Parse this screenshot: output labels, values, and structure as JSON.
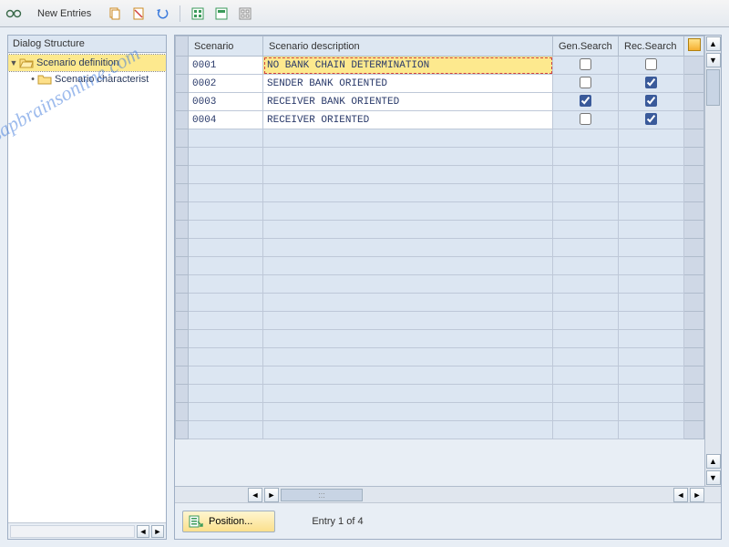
{
  "toolbar": {
    "new_entries_label": "New Entries"
  },
  "dialog_structure": {
    "header": "Dialog Structure",
    "root": {
      "label": "Scenario definition",
      "expanded": true
    },
    "child": {
      "label": "Scenario characterist"
    }
  },
  "table": {
    "headers": {
      "scenario": "Scenario",
      "description": "Scenario description",
      "gen_search": "Gen.Search",
      "rec_search": "Rec.Search"
    },
    "rows": [
      {
        "scenario": "0001",
        "description": "NO BANK CHAIN DETERMINATION",
        "gen": false,
        "rec": false,
        "active": true
      },
      {
        "scenario": "0002",
        "description": "SENDER BANK ORIENTED",
        "gen": false,
        "rec": true,
        "active": false
      },
      {
        "scenario": "0003",
        "description": "RECEIVER BANK ORIENTED",
        "gen": true,
        "rec": true,
        "active": false
      },
      {
        "scenario": "0004",
        "description": "RECEIVER ORIENTED",
        "gen": false,
        "rec": true,
        "active": false
      }
    ]
  },
  "footer": {
    "position_label": "Position...",
    "entry_text": "Entry 1 of 4"
  },
  "watermark": "sapbrainsonline.com"
}
